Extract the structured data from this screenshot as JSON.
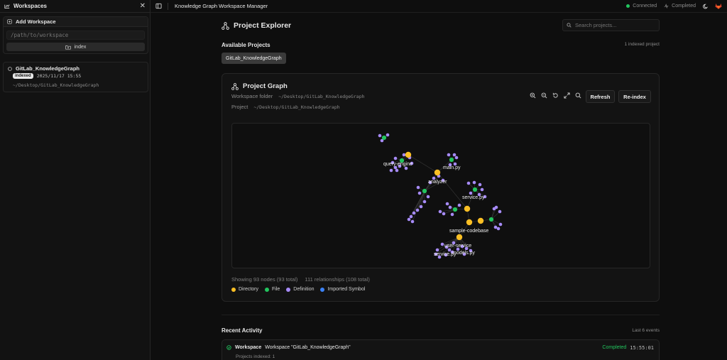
{
  "sidebar": {
    "title": "Workspaces",
    "add_workspace": {
      "title": "Add Workspace",
      "placeholder": "/path/to/workspace",
      "index_label": "index"
    },
    "workspaces": [
      {
        "name": "GitLab_KnowledgeGraph",
        "status": "indexed",
        "date": "2025/11/17 15:55",
        "path": "~/Desktop/GitLab_KnowledgeGraph"
      }
    ]
  },
  "topbar": {
    "title": "Knowledge Graph Workspace Manager",
    "connection": "Connected",
    "job_status": "Completed",
    "colors": {
      "connected": "#22c55e"
    }
  },
  "main": {
    "title": "Project Explorer",
    "search_placeholder": "Search projects...",
    "available_label": "Available Projects",
    "indexed_count": "1 indexed project",
    "projects": [
      "GitLab_KnowledgeGraph"
    ]
  },
  "graph": {
    "title": "Project Graph",
    "workspace_label": "Workspace folder",
    "workspace_value": "~/Desktop/GitLab_KnowledgeGraph",
    "project_label": "Project",
    "project_value": "~/Desktop/GitLab_KnowledgeGraph",
    "refresh": "Refresh",
    "reindex": "Re-index",
    "stats_nodes": "Showing 93 nodes (93 total)",
    "stats_rels": "111 relationships (108 total)",
    "legend": [
      {
        "label": "Directory",
        "color": "#fbbf24"
      },
      {
        "label": "File",
        "color": "#22c55e"
      },
      {
        "label": "Definition",
        "color": "#a78bfa"
      },
      {
        "label": "Imported Symbol",
        "color": "#3b82f6"
      }
    ],
    "node_labels": [
      "query-engine",
      "main.py",
      "analyzer",
      "service.py",
      "sample-codebase",
      "user-service",
      "models.py",
      "service.py"
    ]
  },
  "activity": {
    "title": "Recent Activity",
    "count": "Last 6 events",
    "items": [
      {
        "type": "Workspace",
        "message": "Workspace \"GitLab_KnowledgeGraph\"",
        "status": "Completed",
        "time": "15:55:01",
        "detail": "Projects indexed: 1"
      }
    ]
  }
}
